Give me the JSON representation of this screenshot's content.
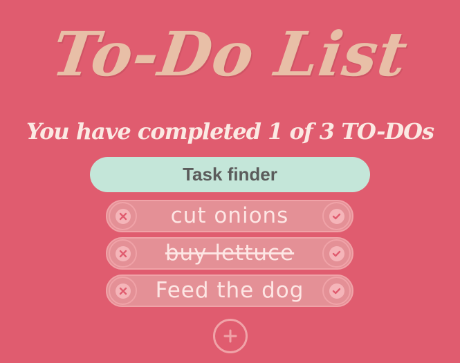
{
  "app": {
    "title": "To-Do List",
    "subtitle": "You have completed 1 of 3 TO-DOs"
  },
  "search": {
    "placeholder": "Task finder"
  },
  "todos": [
    {
      "text": "cut onions",
      "completed": false
    },
    {
      "text": "buy lettuce",
      "completed": true
    },
    {
      "text": "Feed the dog",
      "completed": false
    }
  ],
  "icons": {
    "delete": "x-circle-icon",
    "complete": "check-circle-icon",
    "add": "plus-icon"
  },
  "colors": {
    "background": "#e05c6f",
    "title": "#e8bfa7",
    "search_bg": "#c4e6d9",
    "item_bg": "#e49096"
  }
}
